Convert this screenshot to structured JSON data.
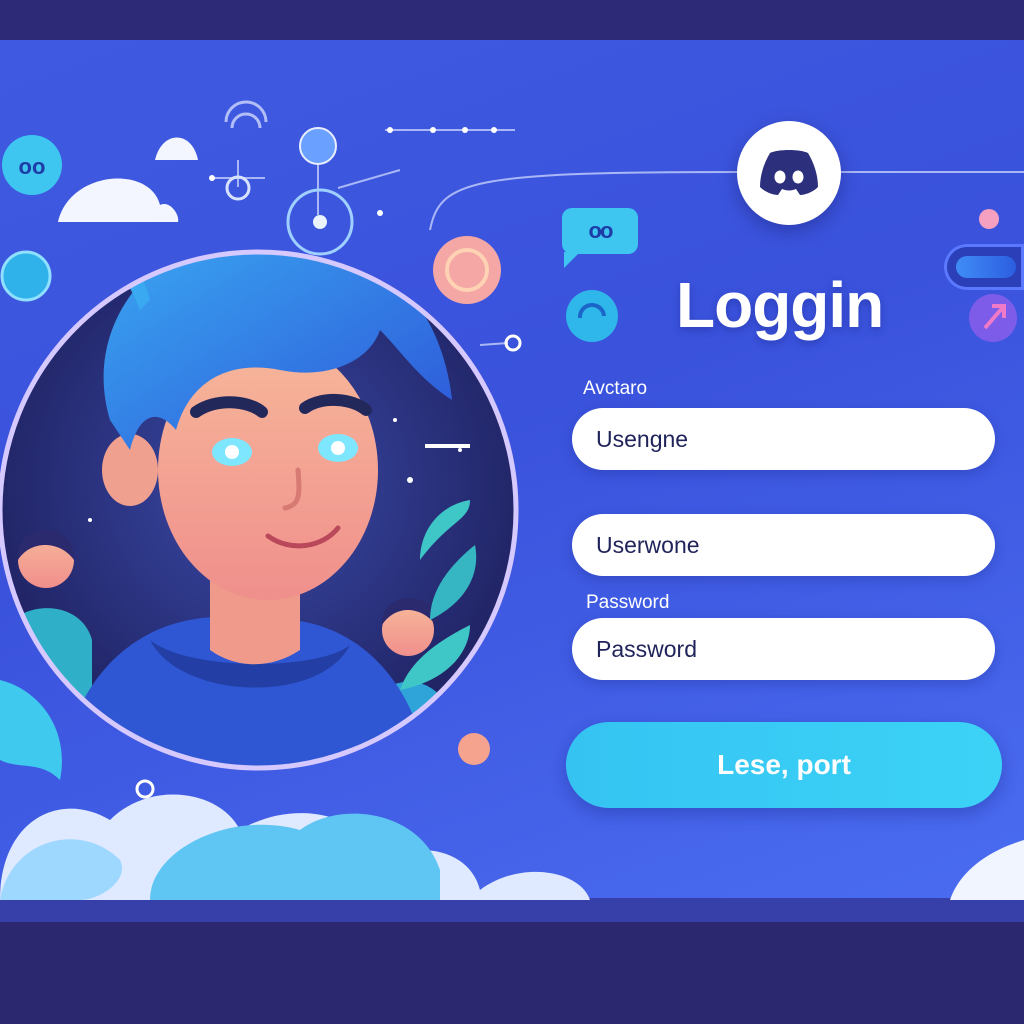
{
  "login": {
    "title": "Loggin",
    "avatar_label": "Avctaro",
    "username_placeholder": "Usengne",
    "username2_placeholder": "Userwone",
    "password_label": "Password",
    "password_placeholder": "Password",
    "submit_label": "Lese, port"
  },
  "icons": {
    "logo": "discord-logo-icon",
    "chat": "chat-bubble-icon",
    "chat_glyph": "oo"
  },
  "colors": {
    "background": "#2d2a78",
    "panel": "#3f5ae0",
    "accent": "#3cd2f6",
    "field": "#ffffff"
  }
}
